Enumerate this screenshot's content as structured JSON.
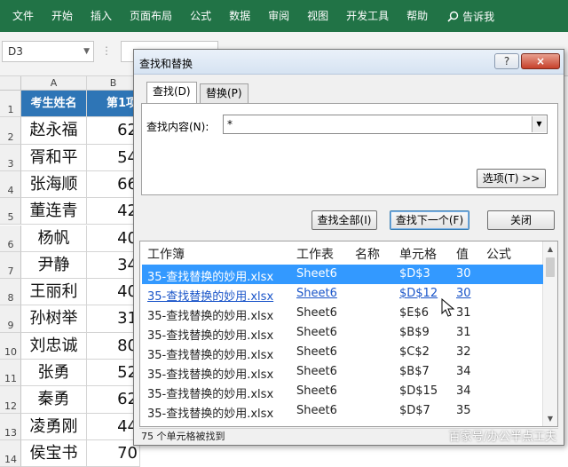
{
  "ribbon": {
    "tabs": [
      "文件",
      "开始",
      "插入",
      "页面布局",
      "公式",
      "数据",
      "审阅",
      "视图",
      "开发工具",
      "帮助"
    ],
    "search_text": "告诉我"
  },
  "formula_bar": {
    "name_box": "D3"
  },
  "sheet": {
    "columns": [
      "A",
      "B"
    ],
    "rows": [
      {
        "n": "1",
        "a": "考生姓名",
        "b": "第1项"
      },
      {
        "n": "2",
        "a": "赵永福",
        "b": "62"
      },
      {
        "n": "3",
        "a": "胥和平",
        "b": "54"
      },
      {
        "n": "4",
        "a": "张海顺",
        "b": "66"
      },
      {
        "n": "5",
        "a": "董连青",
        "b": "42"
      },
      {
        "n": "6",
        "a": "杨帆",
        "b": "40"
      },
      {
        "n": "7",
        "a": "尹静",
        "b": "34"
      },
      {
        "n": "8",
        "a": "王丽利",
        "b": "40"
      },
      {
        "n": "9",
        "a": "孙树举",
        "b": "31"
      },
      {
        "n": "10",
        "a": "刘忠诚",
        "b": "80"
      },
      {
        "n": "11",
        "a": "张勇",
        "b": "52"
      },
      {
        "n": "12",
        "a": "秦勇",
        "b": "62"
      },
      {
        "n": "13",
        "a": "凌勇刚",
        "b": "44"
      },
      {
        "n": "14",
        "a": "侯宝书",
        "b": "70"
      }
    ]
  },
  "dialog": {
    "title": "查找和替换",
    "help": "?",
    "close": "×",
    "tab_find": "查找(D)",
    "tab_replace": "替换(P)",
    "find_label": "查找内容(N):",
    "find_value": "*",
    "options_button": "选项(T) >>",
    "find_all_button": "查找全部(I)",
    "find_next_button": "查找下一个(F)",
    "close_button": "关闭",
    "headers": [
      "工作簿",
      "工作表",
      "名称",
      "单元格",
      "值",
      "公式"
    ],
    "results": [
      {
        "book": "35-查找替换的妙用.xlsx",
        "sheet": "Sheet6",
        "cell": "$D$3",
        "value": "30"
      },
      {
        "book": "35-查找替换的妙用.xlsx",
        "sheet": "Sheet6",
        "cell": "$D$12",
        "value": "30"
      },
      {
        "book": "35-查找替换的妙用.xlsx",
        "sheet": "Sheet6",
        "cell": "$E$6",
        "value": "31"
      },
      {
        "book": "35-查找替换的妙用.xlsx",
        "sheet": "Sheet6",
        "cell": "$B$9",
        "value": "31"
      },
      {
        "book": "35-查找替换的妙用.xlsx",
        "sheet": "Sheet6",
        "cell": "$C$2",
        "value": "32"
      },
      {
        "book": "35-查找替换的妙用.xlsx",
        "sheet": "Sheet6",
        "cell": "$B$7",
        "value": "34"
      },
      {
        "book": "35-查找替换的妙用.xlsx",
        "sheet": "Sheet6",
        "cell": "$D$15",
        "value": "34"
      },
      {
        "book": "35-查找替换的妙用.xlsx",
        "sheet": "Sheet6",
        "cell": "$D$7",
        "value": "35"
      }
    ],
    "status": "75 个单元格被找到"
  },
  "watermark": "百家号/办公半点工夫",
  "colors": {
    "ribbon": "#217346",
    "header_fill": "#2e75b6",
    "selection": "#3399ff"
  }
}
